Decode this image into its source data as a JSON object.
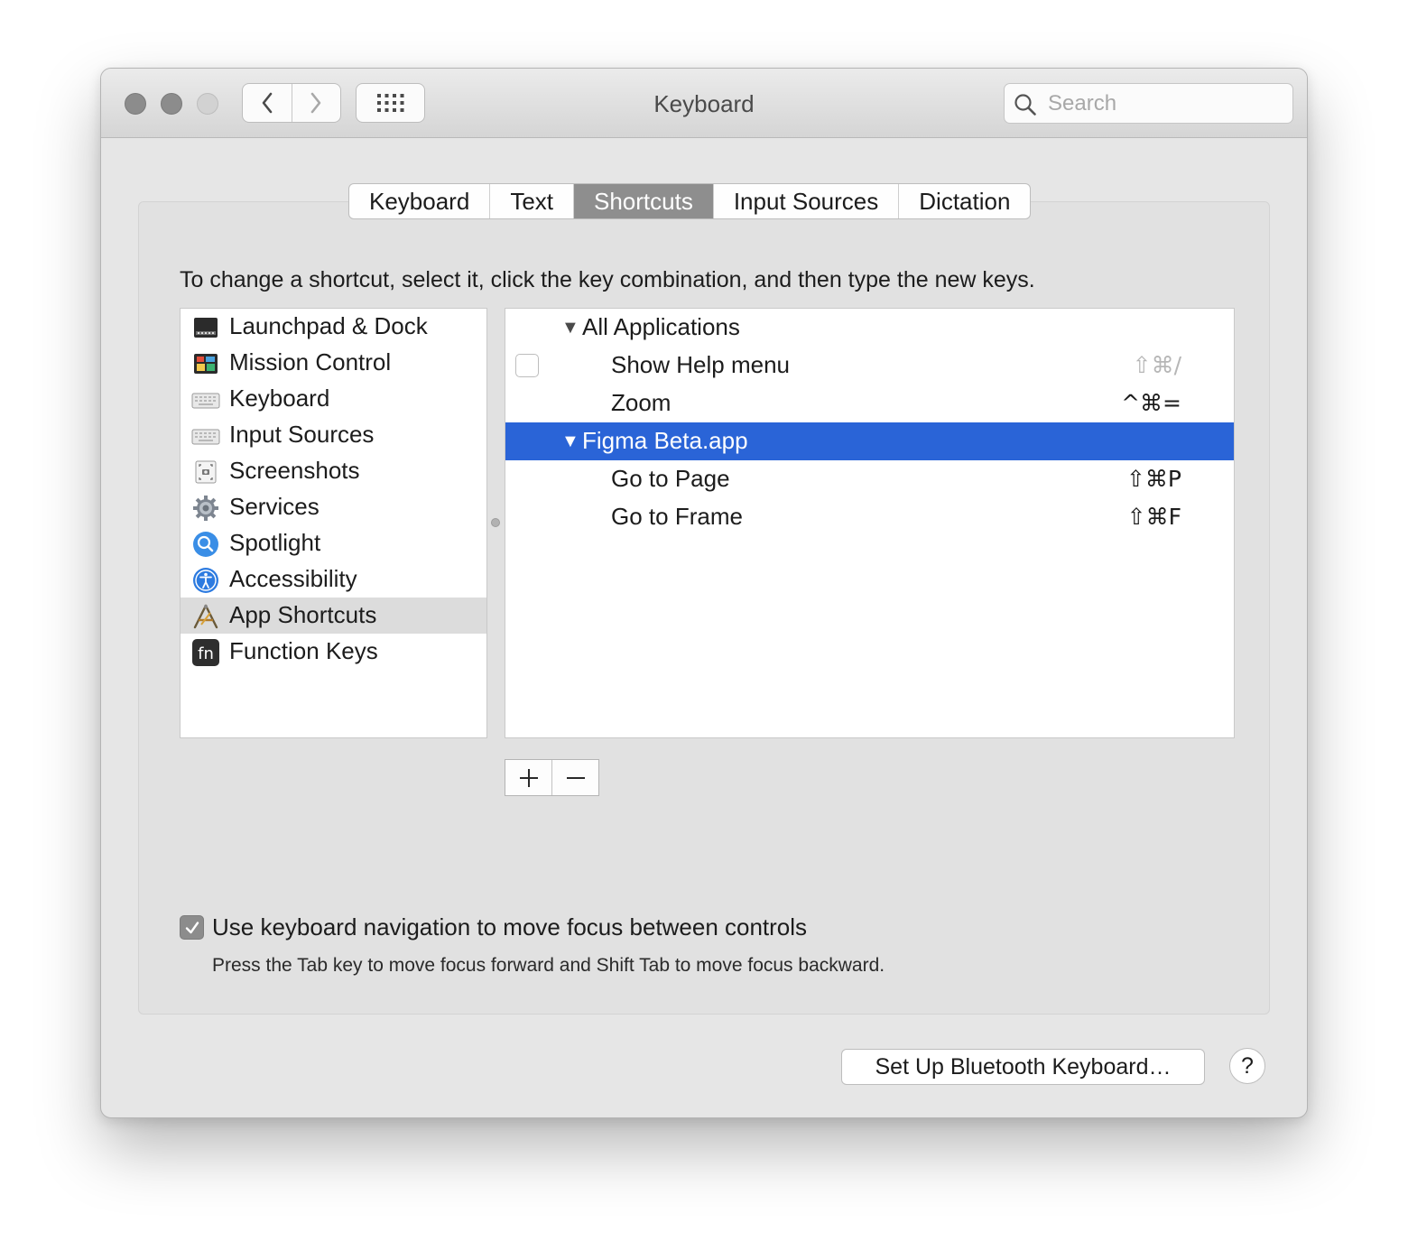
{
  "window": {
    "title": "Keyboard",
    "search_placeholder": "Search"
  },
  "tabs": [
    {
      "label": "Keyboard",
      "selected": false
    },
    {
      "label": "Text",
      "selected": false
    },
    {
      "label": "Shortcuts",
      "selected": true
    },
    {
      "label": "Input Sources",
      "selected": false
    },
    {
      "label": "Dictation",
      "selected": false
    }
  ],
  "instruction": "To change a shortcut, select it, click the key combination, and then type the new keys.",
  "categories": [
    {
      "label": "Launchpad & Dock",
      "icon": "launchpad-dock-icon"
    },
    {
      "label": "Mission Control",
      "icon": "mission-control-icon"
    },
    {
      "label": "Keyboard",
      "icon": "keyboard-icon"
    },
    {
      "label": "Input Sources",
      "icon": "input-sources-icon"
    },
    {
      "label": "Screenshots",
      "icon": "screenshot-icon"
    },
    {
      "label": "Services",
      "icon": "gear-icon"
    },
    {
      "label": "Spotlight",
      "icon": "spotlight-icon"
    },
    {
      "label": "Accessibility",
      "icon": "accessibility-icon"
    },
    {
      "label": "App Shortcuts",
      "icon": "app-shortcuts-icon",
      "selected": true
    },
    {
      "label": "Function Keys",
      "icon": "fn-key-icon"
    }
  ],
  "shortcuts": {
    "all_apps": {
      "label": "All Applications",
      "items": [
        {
          "name": "Show Help menu",
          "keys": "⇧⌘/",
          "enabled": false
        },
        {
          "name": "Zoom",
          "keys": "^⌘="
        }
      ]
    },
    "figma": {
      "label": "Figma Beta.app",
      "items": [
        {
          "name": "Go to Page",
          "keys": "⇧⌘P"
        },
        {
          "name": "Go to Frame",
          "keys": "⇧⌘F"
        }
      ]
    }
  },
  "buttons": {
    "add": "+",
    "remove": "—",
    "bluetooth": "Set Up Bluetooth Keyboard…",
    "help": "?"
  },
  "keyboard_nav": {
    "label": "Use keyboard navigation to move focus between controls",
    "checked": true,
    "help": "Press the Tab key to move focus forward and Shift Tab to move focus backward."
  },
  "colors": {
    "selection": "#2a64d7",
    "selected_tab": "#8e8e8e"
  }
}
